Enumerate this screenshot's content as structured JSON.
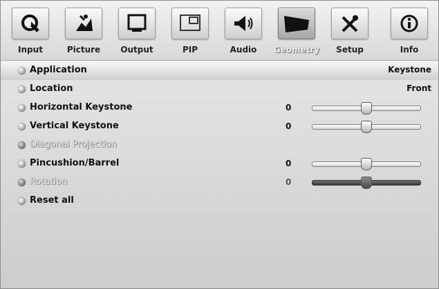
{
  "tabs": [
    {
      "label": "Input",
      "icon": "input-icon"
    },
    {
      "label": "Picture",
      "icon": "picture-icon"
    },
    {
      "label": "Output",
      "icon": "output-icon"
    },
    {
      "label": "PIP",
      "icon": "pip-icon"
    },
    {
      "label": "Audio",
      "icon": "audio-icon"
    },
    {
      "label": "Geometry",
      "icon": "geometry-icon",
      "active": true
    },
    {
      "label": "Setup",
      "icon": "setup-icon"
    },
    {
      "label": "Info",
      "icon": "info-icon"
    }
  ],
  "menu": [
    {
      "label": "Application",
      "value": "Keystone",
      "enabled": true
    },
    {
      "label": "Location",
      "value": "Front",
      "enabled": true
    },
    {
      "label": "Horizontal Keystone",
      "number": "0",
      "slider_fraction": 0.5,
      "enabled": true
    },
    {
      "label": "Vertical Keystone",
      "number": "0",
      "slider_fraction": 0.5,
      "enabled": true
    },
    {
      "label": "Diagonal Projection",
      "enabled": false
    },
    {
      "label": "Pincushion/Barrel",
      "number": "0",
      "slider_fraction": 0.5,
      "enabled": true
    },
    {
      "label": "Rotation",
      "number": "0",
      "slider_fraction": 0.5,
      "enabled": false
    },
    {
      "label": "Reset all",
      "enabled": true
    }
  ]
}
